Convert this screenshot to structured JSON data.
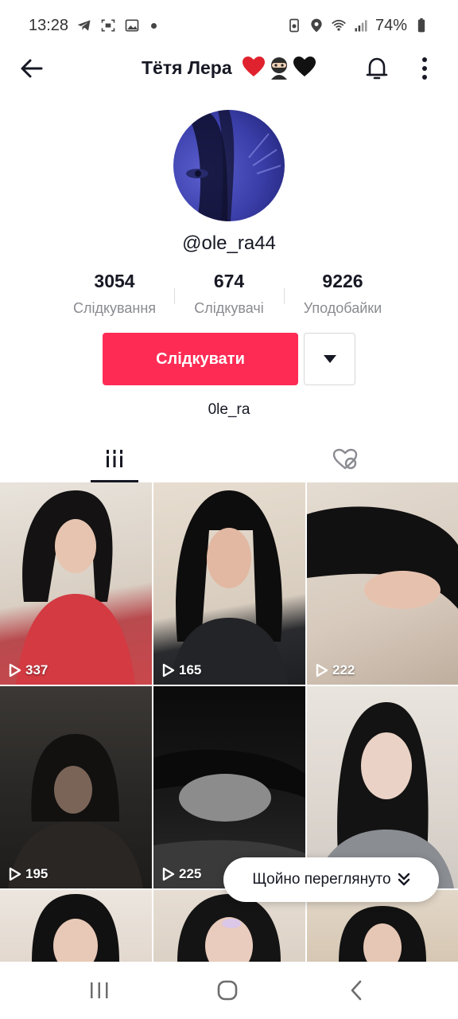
{
  "status_bar": {
    "time": "13:28",
    "battery": "74%"
  },
  "header": {
    "title": "Тётя Лера",
    "title_emojis": [
      "heart",
      "ninja",
      "black-heart"
    ]
  },
  "profile": {
    "username": "@ole_ra44",
    "bio": "0le_ra",
    "stats": [
      {
        "value": "3054",
        "label": "Слідкування"
      },
      {
        "value": "674",
        "label": "Слідкувачі"
      },
      {
        "value": "9226",
        "label": "Уподобайки"
      }
    ],
    "follow_label": "Слідкувати"
  },
  "grid": {
    "tiles": [
      {
        "views": "337"
      },
      {
        "views": "165"
      },
      {
        "views": "222"
      },
      {
        "views": "195"
      },
      {
        "views": "225"
      },
      {
        "views": ""
      },
      {
        "views": ""
      },
      {
        "views": ""
      },
      {
        "views": ""
      }
    ]
  },
  "just_watched_label": "Щойно переглянуто",
  "colors": {
    "accent": "#fe2c55",
    "text": "#161823",
    "muted": "#8a8b91"
  }
}
